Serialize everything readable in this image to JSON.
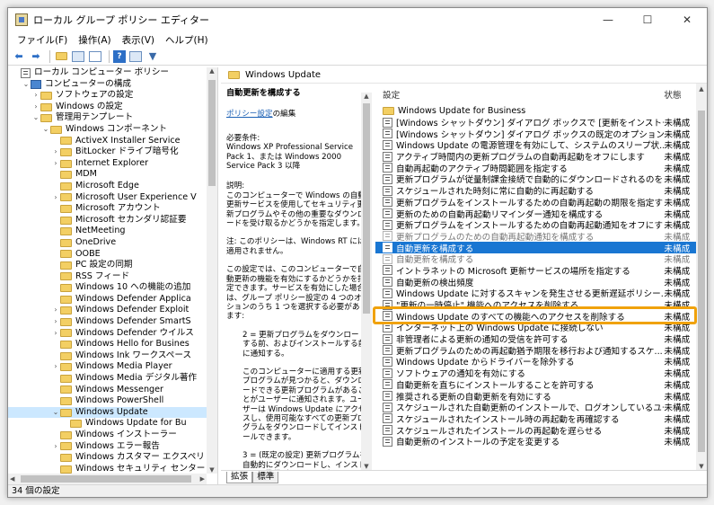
{
  "window": {
    "title": "ローカル グループ ポリシー エディター",
    "min_glyph": "—",
    "max_glyph": "☐",
    "close_glyph": "✕"
  },
  "menu": [
    "ファイル(F)",
    "操作(A)",
    "表示(V)",
    "ヘルプ(H)"
  ],
  "toolbar": {
    "icons": [
      "back-arrow-icon",
      "forward-arrow-icon",
      "folder-up-icon",
      "show-hide-tree-icon",
      "export-list-icon",
      "help-icon",
      "properties-icon",
      "filter-icon"
    ]
  },
  "tree": {
    "rows": [
      {
        "label": "ローカル コンピューター ポリシー",
        "indent": 0,
        "twisty": "",
        "icon": "policy"
      },
      {
        "label": "コンピューターの構成",
        "indent": 1,
        "twisty": "⌄",
        "icon": "computer"
      },
      {
        "label": "ソフトウェアの設定",
        "indent": 2,
        "twisty": "›",
        "icon": "folder"
      },
      {
        "label": "Windows の設定",
        "indent": 2,
        "twisty": "›",
        "icon": "folder"
      },
      {
        "label": "管理用テンプレート",
        "indent": 2,
        "twisty": "⌄",
        "icon": "folder"
      },
      {
        "label": "Windows コンポーネント",
        "indent": 3,
        "twisty": "⌄",
        "icon": "folder"
      },
      {
        "label": "ActiveX Installer Service",
        "indent": 4,
        "twisty": "",
        "icon": "folder"
      },
      {
        "label": "BitLocker ドライブ暗号化",
        "indent": 4,
        "twisty": "›",
        "icon": "folder"
      },
      {
        "label": "Internet Explorer",
        "indent": 4,
        "twisty": "›",
        "icon": "folder"
      },
      {
        "label": "MDM",
        "indent": 4,
        "twisty": "",
        "icon": "folder"
      },
      {
        "label": "Microsoft Edge",
        "indent": 4,
        "twisty": "",
        "icon": "folder"
      },
      {
        "label": "Microsoft User Experience V",
        "indent": 4,
        "twisty": "›",
        "icon": "folder"
      },
      {
        "label": "Microsoft アカウント",
        "indent": 4,
        "twisty": "",
        "icon": "folder"
      },
      {
        "label": "Microsoft セカンダリ認証要",
        "indent": 4,
        "twisty": "",
        "icon": "folder"
      },
      {
        "label": "NetMeeting",
        "indent": 4,
        "twisty": "",
        "icon": "folder"
      },
      {
        "label": "OneDrive",
        "indent": 4,
        "twisty": "",
        "icon": "folder"
      },
      {
        "label": "OOBE",
        "indent": 4,
        "twisty": "",
        "icon": "folder"
      },
      {
        "label": "PC 設定の同期",
        "indent": 4,
        "twisty": "",
        "icon": "folder"
      },
      {
        "label": "RSS フィード",
        "indent": 4,
        "twisty": "",
        "icon": "folder"
      },
      {
        "label": "Windows 10 への機能の追加",
        "indent": 4,
        "twisty": "",
        "icon": "folder"
      },
      {
        "label": "Windows Defender Applica",
        "indent": 4,
        "twisty": "",
        "icon": "folder"
      },
      {
        "label": "Windows Defender Exploit",
        "indent": 4,
        "twisty": "›",
        "icon": "folder"
      },
      {
        "label": "Windows Defender SmartS",
        "indent": 4,
        "twisty": "›",
        "icon": "folder"
      },
      {
        "label": "Windows Defender ウイルス",
        "indent": 4,
        "twisty": "›",
        "icon": "folder"
      },
      {
        "label": "Windows Hello for Busines",
        "indent": 4,
        "twisty": "",
        "icon": "folder"
      },
      {
        "label": "Windows Ink ワークスペース",
        "indent": 4,
        "twisty": "",
        "icon": "folder"
      },
      {
        "label": "Windows Media Player",
        "indent": 4,
        "twisty": "›",
        "icon": "folder"
      },
      {
        "label": "Windows Media デジタル著作",
        "indent": 4,
        "twisty": "",
        "icon": "folder"
      },
      {
        "label": "Windows Messenger",
        "indent": 4,
        "twisty": "",
        "icon": "folder"
      },
      {
        "label": "Windows PowerShell",
        "indent": 4,
        "twisty": "",
        "icon": "folder"
      },
      {
        "label": "Windows Update",
        "indent": 4,
        "twisty": "⌄",
        "icon": "folder",
        "selected": true
      },
      {
        "label": "Windows Update for Bu",
        "indent": 5,
        "twisty": "",
        "icon": "folder"
      },
      {
        "label": "Windows インストーラー",
        "indent": 4,
        "twisty": "",
        "icon": "folder"
      },
      {
        "label": "Windows エラー報告",
        "indent": 4,
        "twisty": "›",
        "icon": "folder"
      },
      {
        "label": "Windows カスタマー エクスペリ",
        "indent": 4,
        "twisty": "",
        "icon": "folder"
      },
      {
        "label": "Windows セキュリティ センター",
        "indent": 4,
        "twisty": "",
        "icon": "folder"
      }
    ]
  },
  "right_header": "Windows Update",
  "description": {
    "heading": "自動更新を構成する",
    "link": "ポリシー設定",
    "link_suffix": "の編集",
    "req_label": "必要条件:",
    "req_text": "Windows XP Professional Service Pack 1、または Windows 2000 Service Pack 3 以降",
    "desc_label": "説明:",
    "desc_text": "このコンピューターで Windows の自動更新サービスを使用してセキュリティ更新プログラムやその他の重要なダウンロードを受け取るかどうかを指定します。",
    "note": "注: このポリシーは、Windows RT には適用されません。",
    "p1": "この設定では、このコンピューターで自動更新の機能を有効にするかどうかを指定できます。サービスを有効にした場合は、グループ ポリシー設定の 4 つのオプションのうち 1 つを選択する必要があります:",
    "p2": "2 = 更新プログラムをダウンロードする前、およびインストールする前に通知する。",
    "p3": "このコンピューターに適用する更新プログラムが見つかると、ダウンロードできる更新プログラムがあることがユーザーに通知されます。ユーザーは Windows Update にアクセスし、使用可能なすべての更新プログラムをダウンロードしてインストールできます。",
    "p4": "3 = (既定の設定) 更新プログラムを自動的にダウンロードし、インストールの準備ができたら通知する。"
  },
  "list": {
    "col_setting": "設定",
    "col_state": "状態",
    "rows": [
      {
        "type": "folder",
        "label": "Windows Update for Business",
        "state": ""
      },
      {
        "type": "policy",
        "label": "[Windows シャットダウン] ダイアログ ボックスで [更新をインストール...",
        "state": "未構成"
      },
      {
        "type": "policy",
        "label": "[Windows シャットダウン] ダイアログ ボックスの既定のオプションを [...",
        "state": "未構成"
      },
      {
        "type": "policy",
        "label": "Windows Update の電源管理を有効にして、システムのスリープ状...",
        "state": "未構成"
      },
      {
        "type": "policy",
        "label": "アクティブ時間内の更新プログラムの自動再起動をオフにします",
        "state": "未構成"
      },
      {
        "type": "policy",
        "label": "自動再起動のアクティブ時間範囲を指定する",
        "state": "未構成"
      },
      {
        "type": "policy",
        "label": "更新プログラムが従量制課金接続で自動的にダウンロードされるのを...",
        "state": "未構成"
      },
      {
        "type": "policy",
        "label": "スケジュールされた時刻に常に自動的に再起動する",
        "state": "未構成"
      },
      {
        "type": "policy",
        "label": "更新プログラムをインストールするための自動再起動の期限を指定する",
        "state": "未構成"
      },
      {
        "type": "policy",
        "label": "更新のための自動再起動リマインダー通知を構成する",
        "state": "未構成"
      },
      {
        "type": "policy",
        "label": "更新プログラムをインストールするための自動再起動通知をオフにする",
        "state": "未構成"
      },
      {
        "type": "policy",
        "label": "更新プログラムのための自動再起動通知を構成する",
        "state": "未構成",
        "faint": true
      },
      {
        "type": "policy",
        "label": "自動更新を構成する",
        "state": "未構成",
        "highlight": true
      },
      {
        "type": "policy",
        "label": "自動更新を構成する",
        "state": "未構成",
        "faint": true
      },
      {
        "type": "policy",
        "label": "イントラネットの Microsoft 更新サービスの場所を指定する",
        "state": "未構成"
      },
      {
        "type": "policy",
        "label": "自動更新の検出頻度",
        "state": "未構成"
      },
      {
        "type": "policy",
        "label": "Windows Update に対するスキャンを発生させる更新遅延ポリシー...",
        "state": "未構成"
      },
      {
        "type": "policy",
        "label": "\"更新の一時停止\" 機能へのアクセスを削除する",
        "state": "未構成"
      },
      {
        "type": "policy",
        "label": "Windows Update のすべての機能へのアクセスを削除する",
        "state": "未構成"
      },
      {
        "type": "policy",
        "label": "インターネット上の Windows Update に接続しない",
        "state": "未構成"
      },
      {
        "type": "policy",
        "label": "非管理者による更新の通知の受信を許可する",
        "state": "未構成"
      },
      {
        "type": "policy",
        "label": "更新プログラムのための再起動猶予期限を移行および通知するスケ...",
        "state": "未構成"
      },
      {
        "type": "policy",
        "label": "Windows Update からドライバーを除外する",
        "state": "未構成"
      },
      {
        "type": "policy",
        "label": "ソフトウェアの通知を有効にする",
        "state": "未構成"
      },
      {
        "type": "policy",
        "label": "自動更新を直ちにインストールすることを許可する",
        "state": "未構成"
      },
      {
        "type": "policy",
        "label": "推奨される更新の自動更新を有効にする",
        "state": "未構成"
      },
      {
        "type": "policy",
        "label": "スケジュールされた自動更新のインストールで、ログオンしているユーザー...",
        "state": "未構成"
      },
      {
        "type": "policy",
        "label": "スケジュールされたインストール時の再起動を再確認する",
        "state": "未構成"
      },
      {
        "type": "policy",
        "label": "スケジュールされたインストールの再起動を遅らせる",
        "state": "未構成"
      },
      {
        "type": "policy",
        "label": "自動更新のインストールの予定を変更する",
        "state": "未構成"
      }
    ]
  },
  "tabs": [
    "拡張",
    "標準"
  ],
  "status": "34 個の設定",
  "colors": {
    "selection": "#1976d2",
    "highlight_frame": "#f0a20c",
    "tree_selection": "#cce8ff",
    "link": "#1a5fb4"
  }
}
